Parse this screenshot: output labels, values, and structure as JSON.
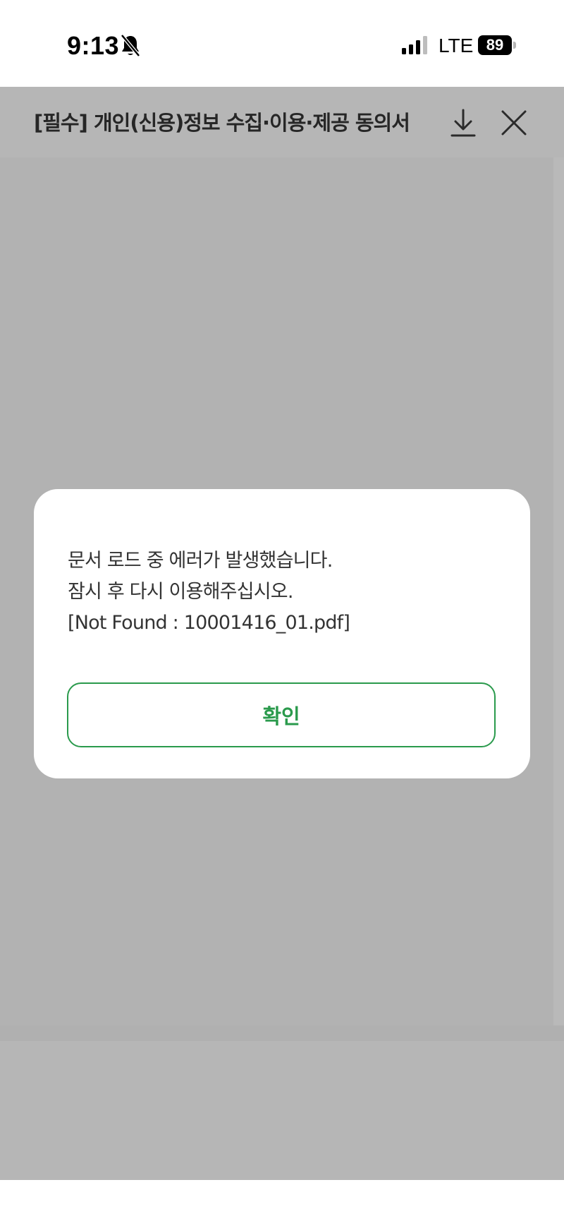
{
  "status_bar": {
    "time": "9:13",
    "network": "LTE",
    "battery": "89",
    "icons": [
      "bell-slash-icon",
      "signal-bars-icon",
      "battery-icon"
    ]
  },
  "header": {
    "title": "[필수] 개인(신용)정보 수집·이용·제공 동의서",
    "icons": [
      "download-icon",
      "close-icon"
    ]
  },
  "dialog": {
    "lines": [
      "문서 로드 중 에러가 발생했습니다.",
      "잠시 후 다시 이용해주십시오.",
      "[Not Found : 10001416_01.pdf]"
    ],
    "confirm_label": "확인"
  },
  "colors": {
    "accent_green": "#2a9a4c",
    "overlay_gray": "#b6b6b6",
    "dialog_background": "#ffffff"
  }
}
